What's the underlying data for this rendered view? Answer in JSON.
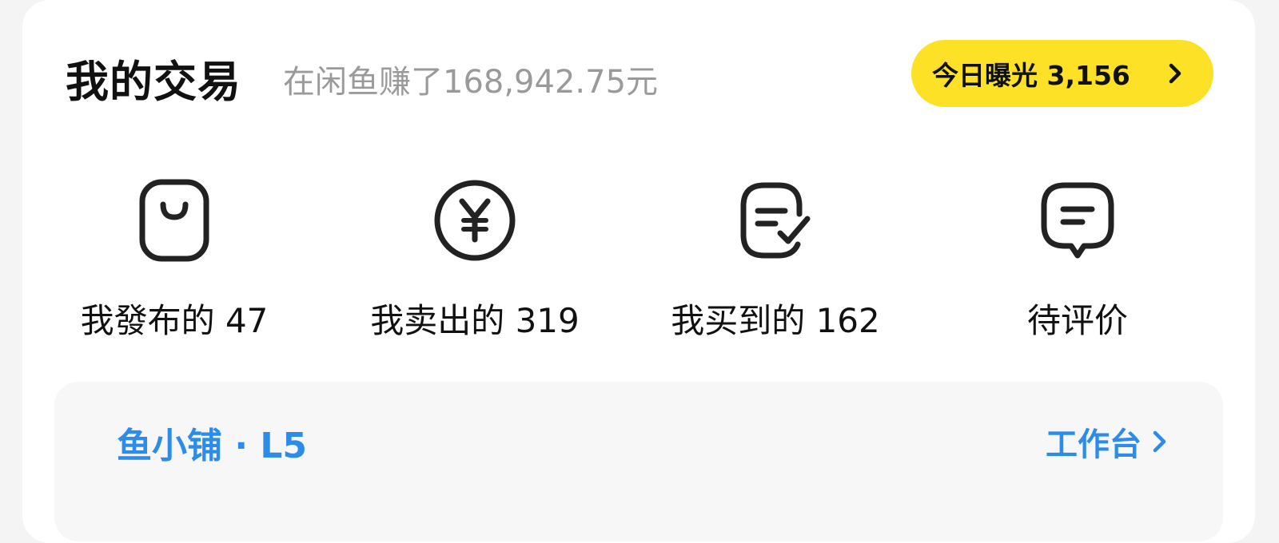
{
  "header": {
    "title": "我的交易",
    "subtitle": "在闲鱼赚了168,942.75元",
    "exposure_label": "今日曝光 3,156",
    "exposure_chevron": "chevron-right-icon"
  },
  "stats": [
    {
      "label": "我發布的 47",
      "icon": "shopping-bag-icon"
    },
    {
      "label": "我卖出的 319",
      "icon": "yuan-coin-icon"
    },
    {
      "label": "我买到的 162",
      "icon": "order-check-icon"
    },
    {
      "label": "待评价",
      "icon": "comment-bubble-icon"
    }
  ],
  "shop": {
    "name": "鱼小铺 · L5",
    "workbench_label": "工作台",
    "workbench_chevron": "chevron-right-icon"
  },
  "colors": {
    "accent_yellow": "#fde127",
    "accent_blue": "#2d8ce8",
    "subtitle_gray": "#9a9a9a"
  }
}
